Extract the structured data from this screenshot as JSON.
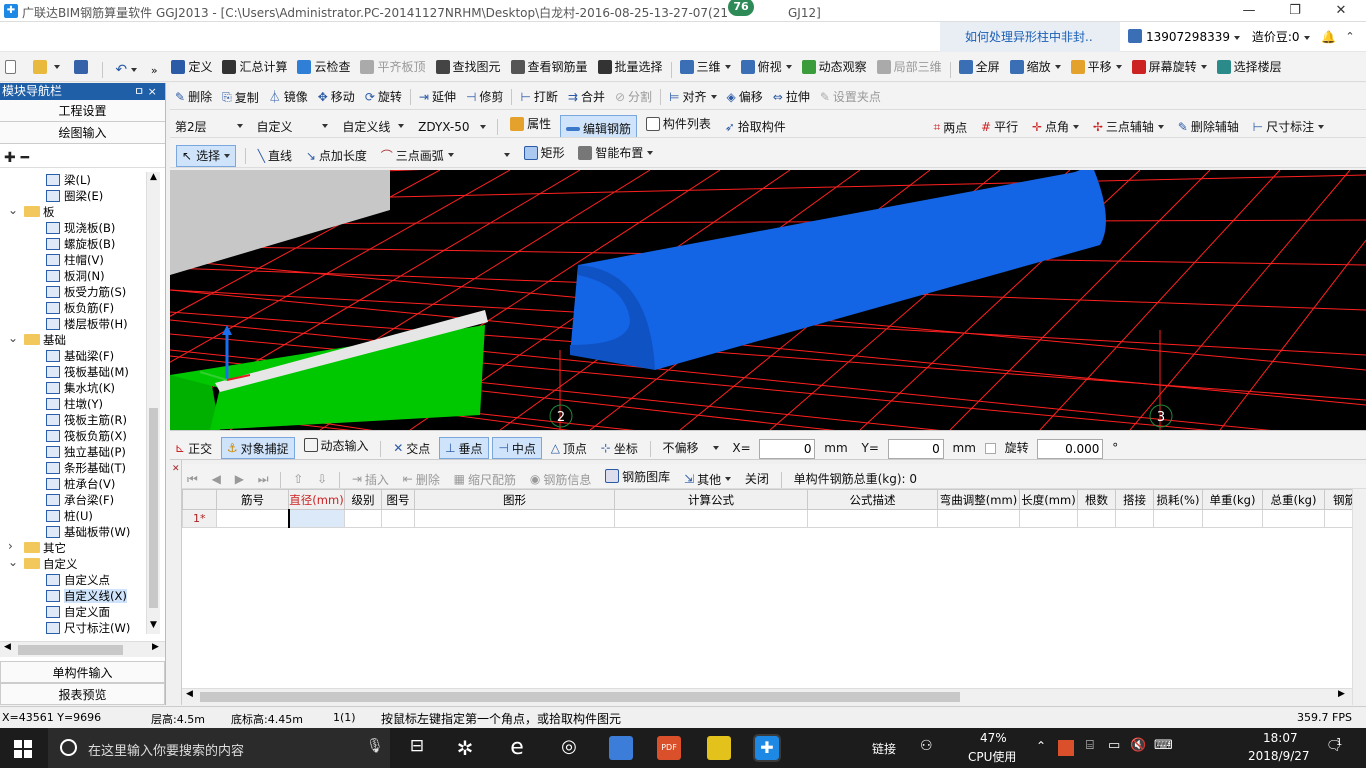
{
  "title": {
    "text": "广联达BIM钢筋算量软件 GGJ2013 - [C:\\Users\\Administrator.PC-20141127NRHM\\Desktop\\白龙村-2016-08-25-13-27-07(21",
    "tail": "GJ12]",
    "badge": "76"
  },
  "infobar": {
    "question": "如何处理异形柱中非封..",
    "phone": "13907298339",
    "price": "造价豆:0"
  },
  "toolbar1": [
    "定义",
    "汇总计算",
    "云检查",
    "平齐板顶",
    "查找图元",
    "查看钢筋量",
    "批量选择",
    "三维",
    "俯视",
    "动态观察",
    "局部三维",
    "全屏",
    "缩放",
    "平移",
    "屏幕旋转",
    "选择楼层"
  ],
  "toolbar2": [
    "删除",
    "复制",
    "镜像",
    "移动",
    "旋转",
    "延伸",
    "修剪",
    "打断",
    "合并",
    "分割",
    "对齐",
    "偏移",
    "拉伸",
    "设置夹点"
  ],
  "toolbar3": {
    "floor": "第2层",
    "type": "自定义",
    "subtype": "自定义线",
    "name": "ZDYX-50",
    "items": [
      "属性",
      "编辑钢筋",
      "构件列表",
      "拾取构件"
    ],
    "axis_items": [
      "两点",
      "平行",
      "点角",
      "三点辅轴",
      "删除辅轴",
      "尺寸标注"
    ]
  },
  "toolbar4": [
    "选择",
    "直线",
    "点加长度",
    "三点画弧",
    "矩形",
    "智能布置"
  ],
  "panel": {
    "header": "模块导航栏",
    "pin": "ㅁ ×",
    "btn1": "工程设置",
    "btn2": "绘图输入",
    "bottom1": "单构件输入",
    "bottom2": "报表预览"
  },
  "tree": [
    {
      "label": "梁(L)",
      "level": 2
    },
    {
      "label": "圈梁(E)",
      "level": 2
    },
    {
      "label": "板",
      "level": 1,
      "folder": true
    },
    {
      "label": "现浇板(B)",
      "level": 2
    },
    {
      "label": "螺旋板(B)",
      "level": 2
    },
    {
      "label": "柱帽(V)",
      "level": 2
    },
    {
      "label": "板洞(N)",
      "level": 2
    },
    {
      "label": "板受力筋(S)",
      "level": 2
    },
    {
      "label": "板负筋(F)",
      "level": 2
    },
    {
      "label": "楼层板带(H)",
      "level": 2
    },
    {
      "label": "基础",
      "level": 1,
      "folder": true
    },
    {
      "label": "基础梁(F)",
      "level": 2
    },
    {
      "label": "筏板基础(M)",
      "level": 2
    },
    {
      "label": "集水坑(K)",
      "level": 2
    },
    {
      "label": "柱墩(Y)",
      "level": 2
    },
    {
      "label": "筏板主筋(R)",
      "level": 2
    },
    {
      "label": "筏板负筋(X)",
      "level": 2
    },
    {
      "label": "独立基础(P)",
      "level": 2
    },
    {
      "label": "条形基础(T)",
      "level": 2
    },
    {
      "label": "桩承台(V)",
      "level": 2
    },
    {
      "label": "承台梁(F)",
      "level": 2
    },
    {
      "label": "桩(U)",
      "level": 2
    },
    {
      "label": "基础板带(W)",
      "level": 2
    },
    {
      "label": "其它",
      "level": 1,
      "folder": true,
      "collapsed": true
    },
    {
      "label": "自定义",
      "level": 1,
      "folder": true
    },
    {
      "label": "自定义点",
      "level": 2
    },
    {
      "label": "自定义线(X)",
      "level": 2,
      "selected": true
    },
    {
      "label": "自定义面",
      "level": 2
    },
    {
      "label": "尺寸标注(W)",
      "level": 2
    }
  ],
  "viewport": {
    "axis_labels": [
      "2",
      "3"
    ]
  },
  "snapbar": {
    "items": [
      "正交",
      "对象捕捉",
      "动态输入",
      "交点",
      "垂点",
      "中点",
      "顶点",
      "坐标"
    ],
    "offset": "不偏移",
    "x_label": "X=",
    "x_val": "0",
    "unit1": "mm",
    "y_label": "Y=",
    "y_val": "0",
    "unit2": "mm",
    "rotate_label": "旋转",
    "rotate_val": "0.000",
    "deg": "°"
  },
  "rebar_toolbar": {
    "items": [
      "插入",
      "删除",
      "缩尺配筋",
      "钢筋信息",
      "钢筋图库",
      "其他",
      "关闭"
    ],
    "total": "单构件钢筋总重(kg): 0"
  },
  "table": {
    "headers": [
      "筋号",
      "直径(mm)",
      "级别",
      "图号",
      "图形",
      "计算公式",
      "公式描述",
      "弯曲调整(mm)",
      "长度(mm)",
      "根数",
      "搭接",
      "损耗(%)",
      "单重(kg)",
      "总重(kg)",
      "钢筋"
    ],
    "row1": "1*"
  },
  "status": {
    "coords": "X=43561 Y=9696",
    "floor_h": "层高:4.5m",
    "base_h": "底标高:4.45m",
    "count": "1(1)",
    "hint": "按鼠标左键指定第一个角点，或拾取构件图元",
    "fps": "359.7 FPS"
  },
  "taskbar": {
    "search": "在这里输入你要搜索的内容",
    "link": "链接",
    "cpu_pct": "47%",
    "cpu_label": "CPU使用",
    "time": "18:07",
    "date": "2018/9/27",
    "notif": "1"
  },
  "colors": {
    "viewport_bg": "#000000",
    "grid": "#ff2020",
    "beam": "#1464e6",
    "wall": "#00c800",
    "title_blue": "#1f5fa8"
  }
}
